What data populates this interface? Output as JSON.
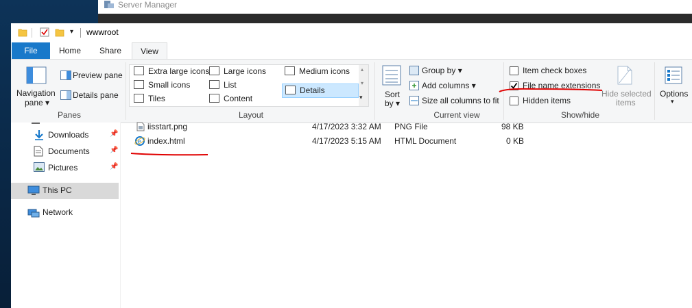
{
  "server_manager": {
    "title": "Server Manager"
  },
  "window": {
    "title": "wwwroot"
  },
  "ribbon_tabs": [
    "File",
    "Home",
    "Share",
    "View"
  ],
  "panes_group": {
    "label": "Panes",
    "navigation_pane_line1": "Navigation",
    "navigation_pane_line2": "pane",
    "preview_pane": "Preview pane",
    "details_pane": "Details pane"
  },
  "layout_group": {
    "label": "Layout",
    "items": [
      "Extra large icons",
      "Large icons",
      "Medium icons",
      "Small icons",
      "List",
      "Details",
      "Tiles",
      "Content"
    ],
    "selected": "Details"
  },
  "current_view_group": {
    "label": "Current view",
    "sort_line1": "Sort",
    "sort_line2": "by",
    "group_by": "Group by",
    "add_columns": "Add columns",
    "size_all_columns": "Size all columns to fit"
  },
  "show_hide_group": {
    "label": "Show/hide",
    "item_check_boxes": "Item check boxes",
    "file_name_extensions": "File name extensions",
    "hidden_items": "Hidden items",
    "hide_selected_line1": "Hide selected",
    "hide_selected_line2": "items",
    "checked": {
      "item_check_boxes": false,
      "file_name_extensions": true,
      "hidden_items": false
    }
  },
  "options": {
    "label": "Options"
  },
  "nav_pane": {
    "items": [
      {
        "label": "Downloads",
        "pinned": true
      },
      {
        "label": "Documents",
        "pinned": true
      },
      {
        "label": "Pictures",
        "pinned": true
      },
      {
        "label": "This PC",
        "selected": true
      },
      {
        "label": "Network"
      }
    ]
  },
  "files": [
    {
      "name": "iisstart.png",
      "date": "4/17/2023 3:32 AM",
      "type": "PNG File",
      "size": "98 KB"
    },
    {
      "name": "index.html",
      "date": "4/17/2023 5:15 AM",
      "type": "HTML Document",
      "size": "0 KB"
    }
  ],
  "colors": {
    "accent": "#1979ca",
    "selection": "#cce8ff",
    "annotation": "#e00000"
  }
}
